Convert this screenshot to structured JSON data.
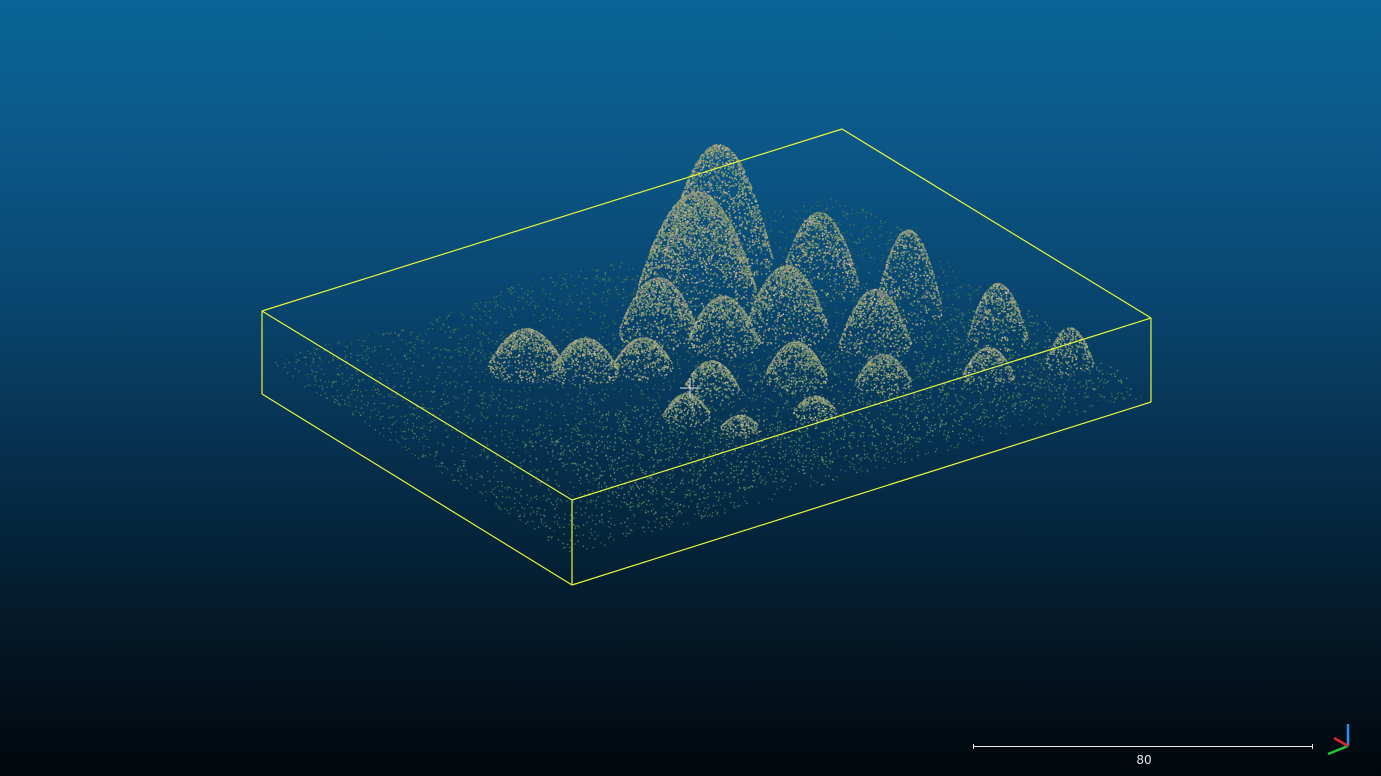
{
  "viewer": {
    "background_top": "#0a6497",
    "background_bottom": "#02070c",
    "bounding_box_color": "#e6f53a",
    "cursor_color": "#d8d8d8"
  },
  "scale_bar": {
    "label": "80"
  },
  "axes": {
    "x_color": "#e0242a",
    "y_color": "#23c43b",
    "z_color": "#2f8cf0"
  },
  "point_cloud": {
    "palette": [
      "#3c6b5a",
      "#4f7f63",
      "#6c8e6a",
      "#8fa178",
      "#a8a26d",
      "#b3a58f",
      "#7d7a9a",
      "#5f6f87",
      "#c9c0a0",
      "#2d5448"
    ]
  }
}
